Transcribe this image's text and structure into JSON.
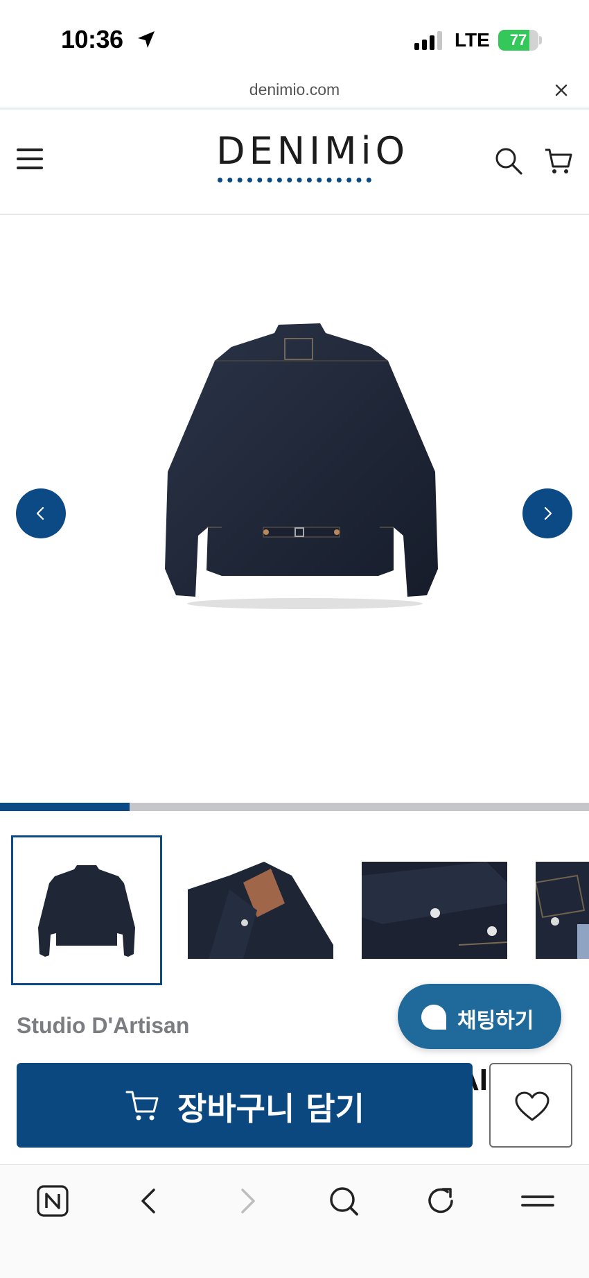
{
  "status_bar": {
    "time": "10:36",
    "network": "LTE",
    "battery_percent": 77,
    "battery_label": "77"
  },
  "browser": {
    "url": "denimio.com"
  },
  "header": {
    "logo_text": "DENIMiO",
    "logo_color": "#0b4b85"
  },
  "gallery": {
    "progress_fraction": 0.22,
    "thumbnail_count_visible": 4,
    "active_thumbnail_index": 0
  },
  "product": {
    "brand": "Studio D'Artisan",
    "title_peek": "AI"
  },
  "chat": {
    "label": "채팅하기"
  },
  "actions": {
    "add_to_cart_label": "장바구니 담기"
  },
  "colors": {
    "brand_blue": "#0b4a85",
    "chat_blue": "#1f6a9a",
    "battery_green": "#34c759"
  },
  "icons": {
    "menu": "hamburger-menu-icon",
    "search": "search-icon",
    "cart": "cart-icon",
    "prev": "chevron-left-icon",
    "next": "chevron-right-icon",
    "wishlist": "heart-icon",
    "chat": "chat-bubble-icon"
  }
}
